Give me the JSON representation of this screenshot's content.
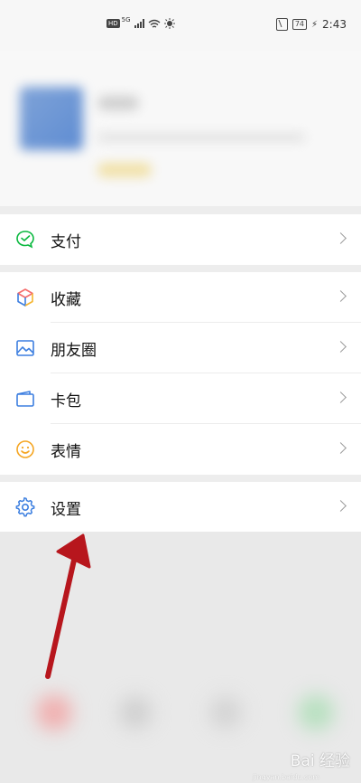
{
  "status_bar": {
    "hd": "HD",
    "network": "5G",
    "battery": "74",
    "time": "2:43"
  },
  "menu": {
    "pay": {
      "label": "支付",
      "icon": "pay-icon"
    },
    "favorites": {
      "label": "收藏",
      "icon": "cube-icon"
    },
    "moments": {
      "label": "朋友圈",
      "icon": "image-icon"
    },
    "cards": {
      "label": "卡包",
      "icon": "card-wallet-icon"
    },
    "stickers": {
      "label": "表情",
      "icon": "smiley-icon"
    },
    "settings": {
      "label": "设置",
      "icon": "gear-icon"
    }
  },
  "watermark": {
    "text": "Bai 经验",
    "sub": "jingyan.baidu.com"
  },
  "colors": {
    "accent_green": "#07c160",
    "arrow_red": "#b7161d"
  }
}
